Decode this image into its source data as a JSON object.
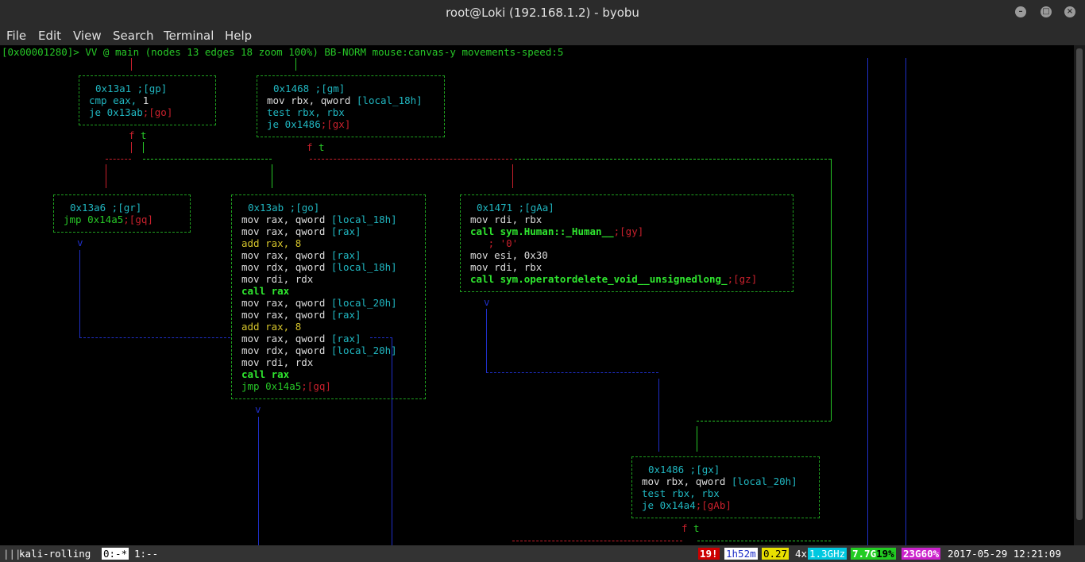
{
  "window": {
    "title": "root@Loki (192.168.1.2) - byobu",
    "minimize_icon": "minimize-icon",
    "maximize_icon": "maximize-icon",
    "close_icon": "close-icon"
  },
  "menu": [
    "File",
    "Edit",
    "View",
    "Search",
    "Terminal",
    "Help"
  ],
  "prompt": "[0x00001280]> VV @ main (nodes 13 edges 18 zoom 100%) BB-NORM mouse:canvas-y movements-speed:5",
  "colors": {
    "terminal_bg": "#000000",
    "edge_true": "#27c727",
    "edge_false": "#c8202c",
    "edge_uncond": "#1f2fc8",
    "status_red": "#cc0000",
    "status_yellow": "#e8e000",
    "status_cyan": "#00c8e0",
    "status_green": "#22cc22",
    "status_magenta": "#cc22cc"
  },
  "graph": {
    "n13a1": {
      "addr": "0x13a1 ;[gp]",
      "l1a": "cmp eax, ",
      "l1b": "1",
      "l2a": "je 0x13ab",
      "l2b": ";[go]"
    },
    "n1468": {
      "addr": "0x1468 ;[gm]",
      "l1a": "mov rbx, qword ",
      "l1b": "[local_18h]",
      "l2": "test rbx, rbx",
      "l3a": "je 0x1486",
      "l3b": ";[gx]"
    },
    "n13a6": {
      "addr": "0x13a6 ;[gr]",
      "l1a": "jmp 0x14a5",
      "l1b": ";[gq]"
    },
    "n13ab": {
      "addr": "0x13ab ;[go]",
      "l1a": "mov rax, qword ",
      "l1b": "[local_18h]",
      "l2a": "mov rax, qword ",
      "l2b": "[rax]",
      "l3": "add rax, 8",
      "l4a": "mov rax, qword ",
      "l4b": "[rax]",
      "l5a": "mov rdx, qword ",
      "l5b": "[local_18h]",
      "l6": "mov rdi, rdx",
      "l7": "call rax",
      "l8a": "mov rax, qword ",
      "l8b": "[local_20h]",
      "l9a": "mov rax, qword ",
      "l9b": "[rax]",
      "l10": "add rax, 8",
      "l11a": "mov rax, qword ",
      "l11b": "[rax]",
      "l12a": "mov rdx, qword ",
      "l12b": "[local_20h]",
      "l13": "mov rdi, rdx",
      "l14": "call rax",
      "l15a": "jmp 0x14a5",
      "l15b": ";[gq]"
    },
    "n1471": {
      "addr": "0x1471 ;[gAa]",
      "l1": "mov rdi, rbx",
      "l2a": "call sym.Human::_Human__",
      "l2b": ";[gy]",
      "l3": "   ; '0'",
      "l4": "mov esi, 0x30",
      "l5": "mov rdi, rbx",
      "l6a": "call sym.operatordelete_void__unsignedlong_",
      "l6b": ";[gz]"
    },
    "n1486": {
      "addr": "0x1486 ;[gx]",
      "l1a": "mov rbx, qword ",
      "l1b": "[local_20h]",
      "l2": "test rbx, rbx",
      "l3a": "je 0x14a4",
      "l3b": ";[gAb]"
    },
    "ft1": {
      "f": "f",
      "t": "t"
    },
    "ft2": {
      "f": "f",
      "t": "t"
    },
    "ft3": {
      "f": "f",
      "t": "t"
    },
    "arrow": "v"
  },
  "status": {
    "session": "kali-rolling",
    "win_active": "0:-*",
    "win_other": "1:--",
    "updates": "19!",
    "uptime": "1h52m",
    "load": "0.27",
    "cpu_count": "4x",
    "cpu_freq": "1.3GHz",
    "mem_total": "7.7G",
    "mem_used": "19%",
    "disk_total": "23G",
    "disk_used": "60%",
    "datetime": "2017-05-29 12:21:09"
  }
}
